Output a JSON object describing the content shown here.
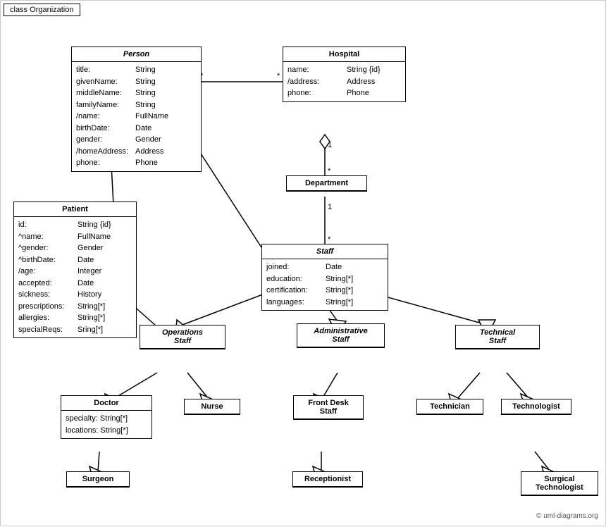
{
  "diagram": {
    "title": "class Organization",
    "copyright": "© uml-diagrams.org"
  },
  "classes": {
    "person": {
      "name": "Person",
      "italic": true,
      "attrs": [
        {
          "name": "title:",
          "type": "String"
        },
        {
          "name": "givenName:",
          "type": "String"
        },
        {
          "name": "middleName:",
          "type": "String"
        },
        {
          "name": "familyName:",
          "type": "String"
        },
        {
          "name": "/name:",
          "type": "FullName"
        },
        {
          "name": "birthDate:",
          "type": "Date"
        },
        {
          "name": "gender:",
          "type": "Gender"
        },
        {
          "name": "/homeAddress:",
          "type": "Address"
        },
        {
          "name": "phone:",
          "type": "Phone"
        }
      ]
    },
    "hospital": {
      "name": "Hospital",
      "italic": false,
      "attrs": [
        {
          "name": "name:",
          "type": "String {id}"
        },
        {
          "name": "/address:",
          "type": "Address"
        },
        {
          "name": "phone:",
          "type": "Phone"
        }
      ]
    },
    "patient": {
      "name": "Patient",
      "italic": false,
      "attrs": [
        {
          "name": "id:",
          "type": "String {id}"
        },
        {
          "name": "^name:",
          "type": "FullName"
        },
        {
          "name": "^gender:",
          "type": "Gender"
        },
        {
          "name": "^birthDate:",
          "type": "Date"
        },
        {
          "name": "/age:",
          "type": "Integer"
        },
        {
          "name": "accepted:",
          "type": "Date"
        },
        {
          "name": "sickness:",
          "type": "History"
        },
        {
          "name": "prescriptions:",
          "type": "String[*]"
        },
        {
          "name": "allergies:",
          "type": "String[*]"
        },
        {
          "name": "specialReqs:",
          "type": "Sring[*]"
        }
      ]
    },
    "department": {
      "name": "Department",
      "italic": false,
      "attrs": []
    },
    "staff": {
      "name": "Staff",
      "italic": true,
      "attrs": [
        {
          "name": "joined:",
          "type": "Date"
        },
        {
          "name": "education:",
          "type": "String[*]"
        },
        {
          "name": "certification:",
          "type": "String[*]"
        },
        {
          "name": "languages:",
          "type": "String[*]"
        }
      ]
    },
    "operations_staff": {
      "name": "Operations Staff",
      "italic": true,
      "attrs": []
    },
    "administrative_staff": {
      "name": "Administrative Staff",
      "italic": true,
      "attrs": []
    },
    "technical_staff": {
      "name": "Technical Staff",
      "italic": true,
      "attrs": []
    },
    "doctor": {
      "name": "Doctor",
      "italic": false,
      "attrs": [
        {
          "name": "specialty:",
          "type": "String[*]"
        },
        {
          "name": "locations:",
          "type": "String[*]"
        }
      ]
    },
    "nurse": {
      "name": "Nurse",
      "italic": false,
      "attrs": []
    },
    "front_desk_staff": {
      "name": "Front Desk Staff",
      "italic": false,
      "attrs": []
    },
    "technician": {
      "name": "Technician",
      "italic": false,
      "attrs": []
    },
    "technologist": {
      "name": "Technologist",
      "italic": false,
      "attrs": []
    },
    "surgeon": {
      "name": "Surgeon",
      "italic": false,
      "attrs": []
    },
    "receptionist": {
      "name": "Receptionist",
      "italic": false,
      "attrs": []
    },
    "surgical_technologist": {
      "name": "Surgical Technologist",
      "italic": false,
      "attrs": []
    }
  }
}
